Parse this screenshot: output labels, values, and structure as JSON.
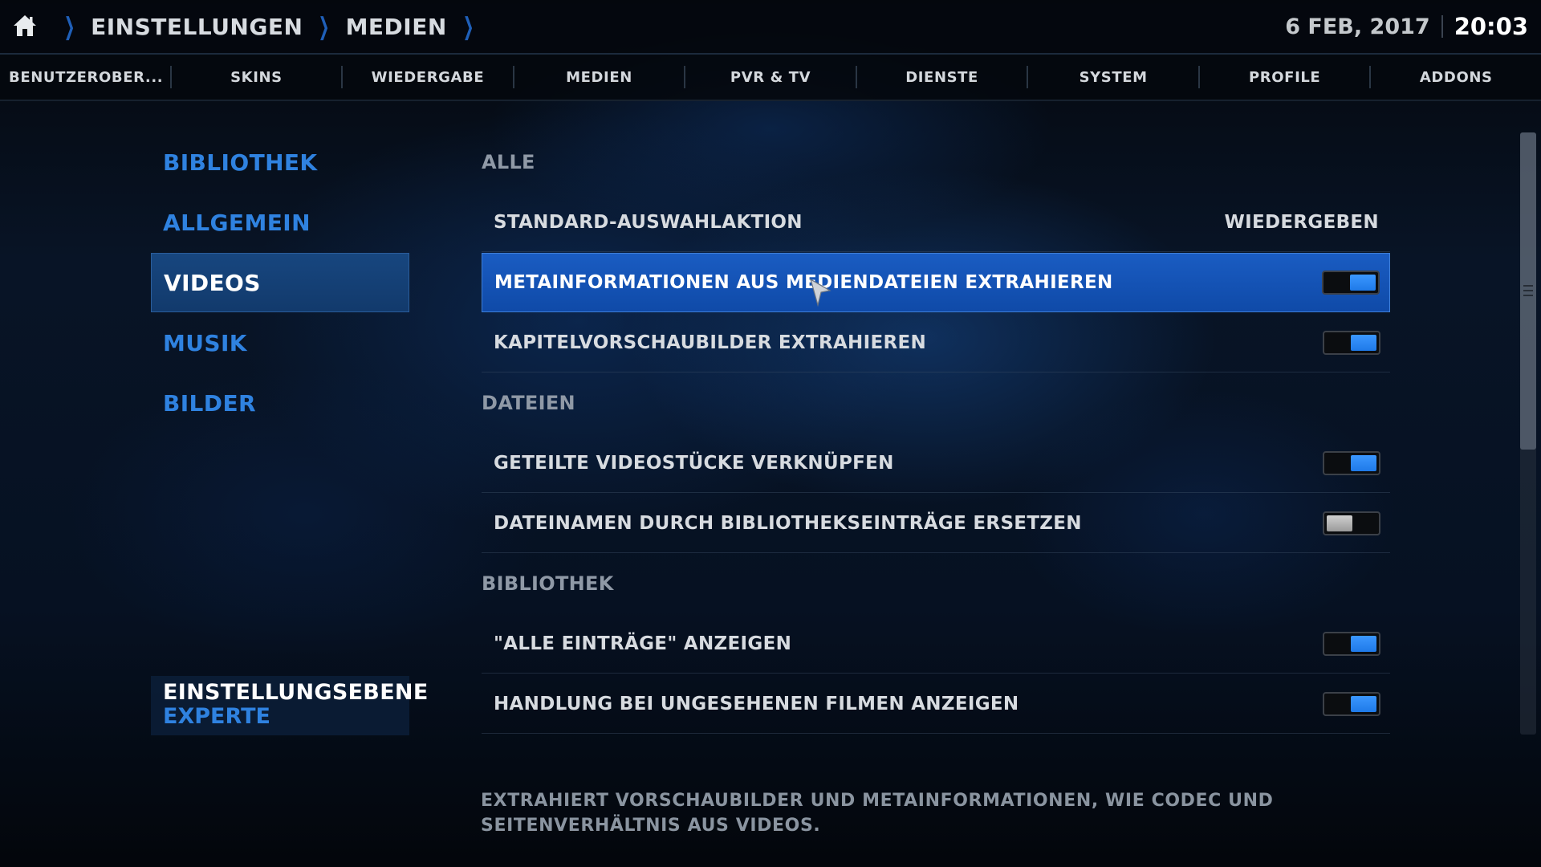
{
  "breadcrumb": {
    "items": [
      "EINSTELLUNGEN",
      "MEDIEN"
    ]
  },
  "clock": {
    "date": "6 FEB, 2017",
    "time": "20:03"
  },
  "tabs": [
    {
      "label": "BENUTZEROBER..."
    },
    {
      "label": "SKINS"
    },
    {
      "label": "WIEDERGABE"
    },
    {
      "label": "MEDIEN"
    },
    {
      "label": "PVR & TV"
    },
    {
      "label": "DIENSTE"
    },
    {
      "label": "SYSTEM"
    },
    {
      "label": "PROFILE"
    },
    {
      "label": "ADDONS"
    }
  ],
  "sidebar": {
    "items": [
      {
        "label": "BIBLIOTHEK"
      },
      {
        "label": "ALLGEMEIN"
      },
      {
        "label": "VIDEOS",
        "active": true
      },
      {
        "label": "MUSIK"
      },
      {
        "label": "BILDER"
      }
    ],
    "settings_level": {
      "title": "EINSTELLUNGSEBENE",
      "value": "EXPERTE"
    }
  },
  "settings": {
    "sections": [
      {
        "title": "ALLE",
        "rows": [
          {
            "label": "STANDARD-AUSWAHLAKTION",
            "value": "WIEDERGEBEN"
          },
          {
            "label": "METAINFORMATIONEN AUS MEDIENDATEIEN EXTRAHIEREN",
            "toggle": true,
            "focused": true
          },
          {
            "label": "KAPITELVORSCHAUBILDER EXTRAHIEREN",
            "toggle": true
          }
        ]
      },
      {
        "title": "DATEIEN",
        "rows": [
          {
            "label": "GETEILTE VIDEOSTÜCKE VERKNÜPFEN",
            "toggle": true
          },
          {
            "label": "DATEINAMEN DURCH BIBLIOTHEKSEINTRÄGE ERSETZEN",
            "toggle": false
          }
        ]
      },
      {
        "title": "BIBLIOTHEK",
        "rows": [
          {
            "label": "\"ALLE EINTRÄGE\" ANZEIGEN",
            "toggle": true
          },
          {
            "label": "HANDLUNG BEI UNGESEHENEN FILMEN ANZEIGEN",
            "toggle": true
          }
        ]
      }
    ]
  },
  "description": "EXTRAHIERT VORSCHAUBILDER UND METAINFORMATIONEN, WIE CODEC UND SEITENVERHÄLTNIS AUS VIDEOS.",
  "colors": {
    "accent": "#2f82e0",
    "focus": "#1552b4",
    "toggle_on": "#2b88f5",
    "toggle_off": "#b8b8b8"
  },
  "icons": {
    "home": "home-icon",
    "separator": "chevron-right-icon",
    "pointer": "mouse-pointer-icon"
  }
}
